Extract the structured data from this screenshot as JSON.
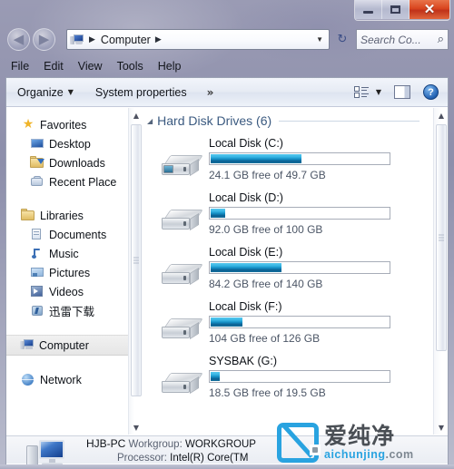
{
  "window": {
    "buttons": {
      "minimize": "—",
      "maximize": "□",
      "close": "✕"
    }
  },
  "nav": {
    "back_arrow": "◀",
    "forward_arrow": "▶",
    "breadcrumb": {
      "root": "Computer",
      "sep": "▶",
      "dropdown": "▼"
    },
    "refresh": "↻",
    "search": {
      "placeholder": "Search Co...",
      "icon": "⌕"
    }
  },
  "menubar": {
    "items": [
      "File",
      "Edit",
      "View",
      "Tools",
      "Help"
    ]
  },
  "commandbar": {
    "organize_label": "Organize",
    "organize_caret": "▼",
    "system_properties_label": "System properties",
    "overflow_label": "»",
    "view_caret": "▼",
    "help_label": "?"
  },
  "sidebar": {
    "groups": [
      {
        "header": {
          "label": "Favorites",
          "icon": "star-icon"
        },
        "items": [
          {
            "label": "Desktop",
            "icon": "desktop-icon"
          },
          {
            "label": "Downloads",
            "icon": "downloads-icon"
          },
          {
            "label": "Recent Place",
            "icon": "recent-places-icon"
          }
        ]
      },
      {
        "header": {
          "label": "Libraries",
          "icon": "libraries-icon"
        },
        "items": [
          {
            "label": "Documents",
            "icon": "documents-icon"
          },
          {
            "label": "Music",
            "icon": "music-icon"
          },
          {
            "label": "Pictures",
            "icon": "pictures-icon"
          },
          {
            "label": "Videos",
            "icon": "videos-icon"
          },
          {
            "label": "迅雷下载",
            "icon": "thunder-download-icon"
          }
        ]
      }
    ],
    "computer": {
      "label": "Computer",
      "icon": "computer-icon",
      "selected": true
    },
    "network": {
      "label": "Network",
      "icon": "network-icon",
      "selected": false
    }
  },
  "content": {
    "group_title": "Hard Disk Drives (6)",
    "group_triangle": "◢",
    "drives": [
      {
        "name": "Local Disk (C:)",
        "free_text": "24.1 GB free of 49.7 GB",
        "used_percent": 51,
        "warn": false
      },
      {
        "name": "Local Disk (D:)",
        "free_text": "92.0 GB free of 100 GB",
        "used_percent": 8,
        "warn": false
      },
      {
        "name": "Local Disk (E:)",
        "free_text": "84.2 GB free of 140 GB",
        "used_percent": 40,
        "warn": false
      },
      {
        "name": "Local Disk (F:)",
        "free_text": "104 GB free of 126 GB",
        "used_percent": 18,
        "warn": false
      },
      {
        "name": "SYSBAK (G:)",
        "free_text": "18.5 GB free of 19.5 GB",
        "used_percent": 5,
        "warn": false
      }
    ]
  },
  "details": {
    "computer_name": "HJB-PC",
    "workgroup_label": "Workgroup:",
    "workgroup_value": "WORKGROUP",
    "processor_label": "Processor:",
    "processor_value": "Intel(R) Core(TM"
  },
  "watermark": {
    "cn_text": "爱纯净",
    "en_text": "aichunjing",
    "en_suffix": ".com"
  },
  "scroll": {
    "up_arrow": "▲",
    "down_arrow": "▼"
  },
  "colors": {
    "accent_blue": "#1590c6",
    "close_red": "#d9451f",
    "group_title": "#3b5a80",
    "watermark_blue": "#29a3e0"
  }
}
